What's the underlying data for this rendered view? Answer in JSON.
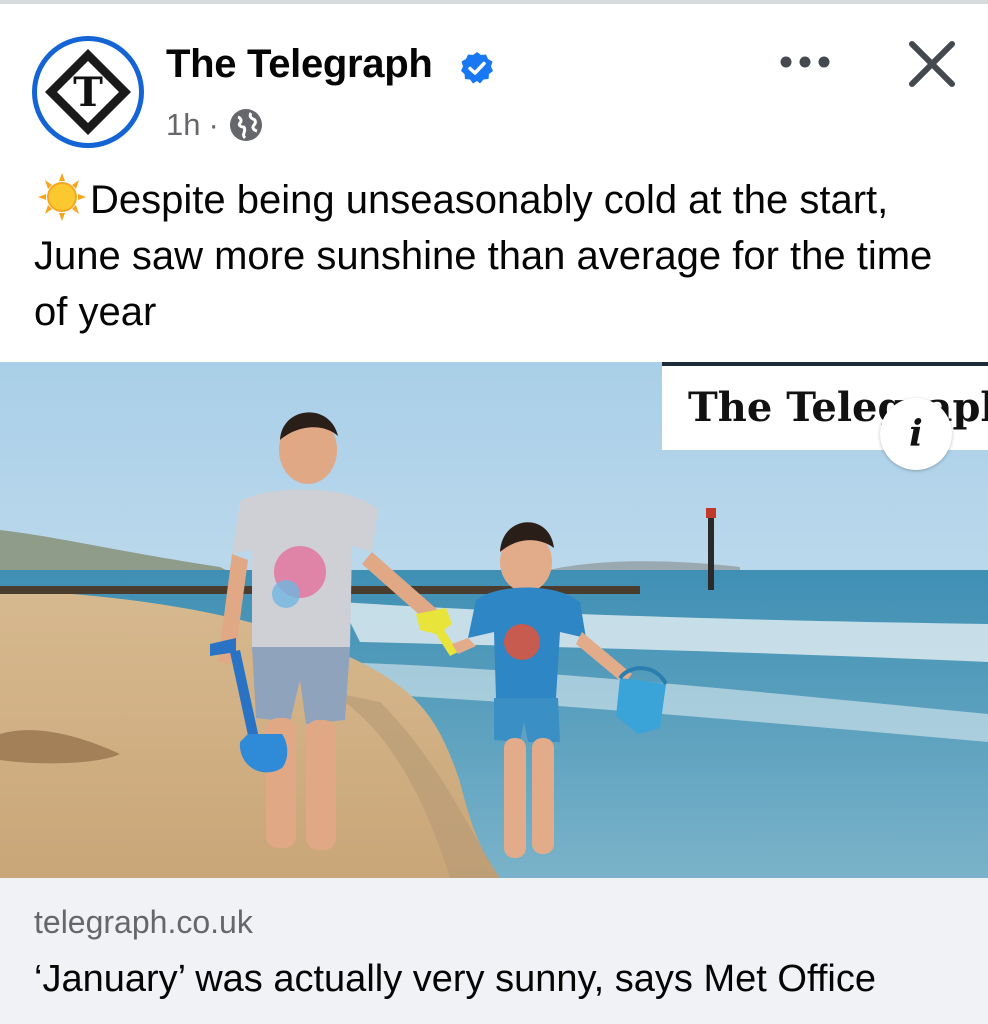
{
  "post": {
    "page_name": "The Telegraph",
    "time": "1h",
    "separator": "·",
    "audience_icon": "globe-icon",
    "verified_icon": "verified-badge-icon",
    "text": "Despite being unseasonably cold at the start, June saw more sunshine than average for the time of year",
    "emoji": "sun-emoji-icon"
  },
  "actions": {
    "more_icon": "more-options-icon",
    "close_icon": "close-icon"
  },
  "image": {
    "description_icon": "info-icon",
    "watermark": "The Telegraph",
    "info_glyph": "i"
  },
  "link": {
    "domain": "telegraph.co.uk",
    "headline": "‘January’ was actually very sunny, says Met Office"
  },
  "colors": {
    "accent_blue": "#1464d6",
    "text_primary": "#050505",
    "text_secondary": "#65676b",
    "card_bg": "#f0f2f5"
  }
}
